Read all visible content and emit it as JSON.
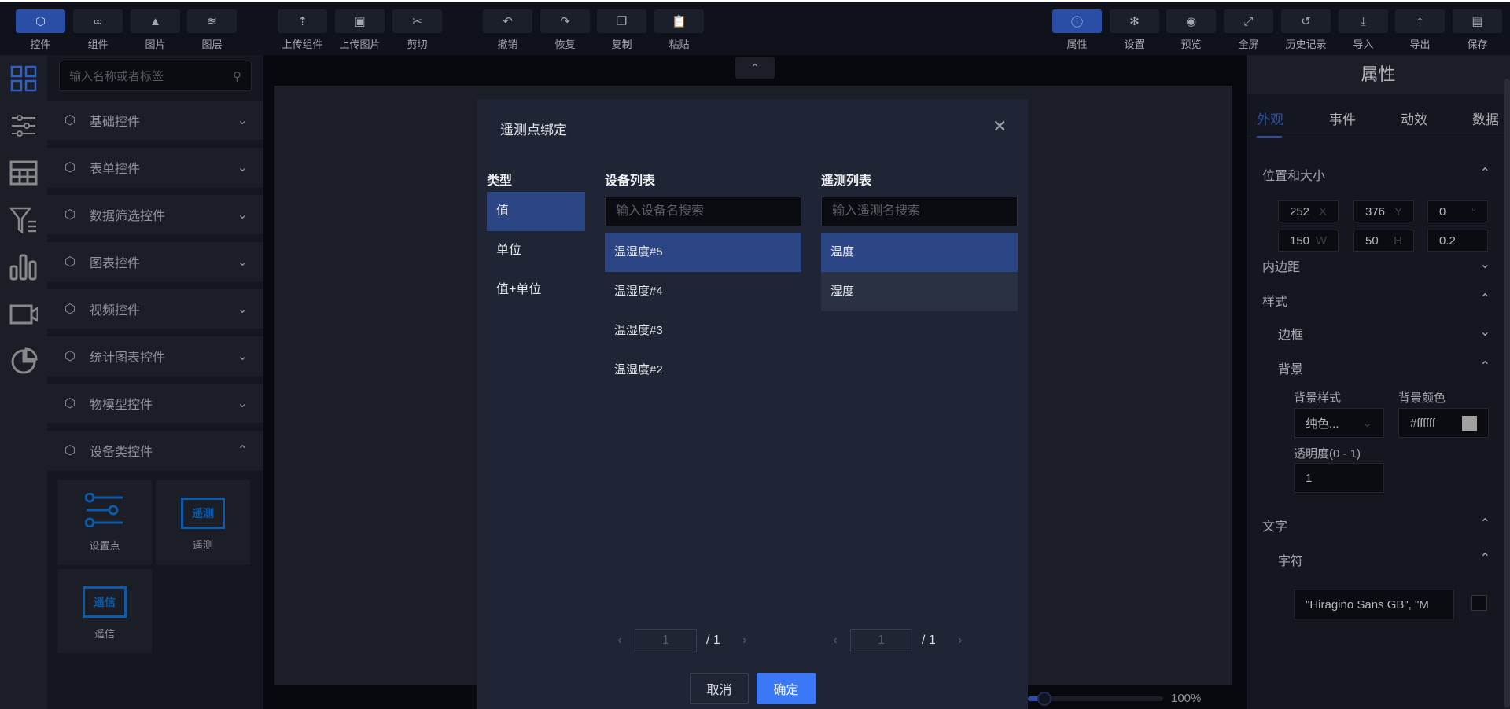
{
  "toolbar": {
    "left": [
      {
        "label": "控件",
        "icon": "cube-icon",
        "active": true
      },
      {
        "label": "组件",
        "icon": "link-icon"
      },
      {
        "label": "图片",
        "icon": "image-icon"
      },
      {
        "label": "图层",
        "icon": "layers-icon"
      },
      {
        "label": "上传组件",
        "icon": "upload-component-icon"
      },
      {
        "label": "上传图片",
        "icon": "upload-image-icon"
      },
      {
        "label": "剪切",
        "icon": "cut-icon"
      },
      {
        "label": "撤销",
        "icon": "undo-icon"
      },
      {
        "label": "恢复",
        "icon": "redo-icon"
      },
      {
        "label": "复制",
        "icon": "copy-icon"
      },
      {
        "label": "粘贴",
        "icon": "paste-icon"
      }
    ],
    "right": [
      {
        "label": "属性",
        "icon": "info-icon",
        "active": true
      },
      {
        "label": "设置",
        "icon": "gear-icon"
      },
      {
        "label": "预览",
        "icon": "eye-icon"
      },
      {
        "label": "全屏",
        "icon": "fullscreen-icon"
      },
      {
        "label": "历史记录",
        "icon": "history-icon"
      },
      {
        "label": "导入",
        "icon": "import-icon"
      },
      {
        "label": "导出",
        "icon": "export-icon"
      },
      {
        "label": "保存",
        "icon": "save-icon"
      }
    ]
  },
  "sidebar": {
    "search_placeholder": "输入名称或者标签",
    "categories": [
      "基础控件",
      "表单控件",
      "数据筛选控件",
      "图表控件",
      "视频控件",
      "统计图表控件",
      "物模型控件",
      "设备类控件"
    ],
    "tiles": [
      {
        "label": "设置点"
      },
      {
        "label": "遥测",
        "icon_text": "遥测"
      },
      {
        "label": "遥信",
        "icon_text": "遥信"
      }
    ]
  },
  "canvas": {
    "zoom": "100%",
    "zoom_fraction": 0.12
  },
  "properties": {
    "title": "属性",
    "tabs": [
      "外观",
      "事件",
      "动效",
      "数据"
    ],
    "sections": {
      "position": "位置和大小",
      "padding": "内边距",
      "style": "样式",
      "border": "边框",
      "background": "背景",
      "text": "文字",
      "font": "字符"
    },
    "fields": {
      "x": "252",
      "x_unit": "X",
      "y": "376",
      "y_unit": "Y",
      "rotate": "0",
      "rotate_unit": "°",
      "w": "150",
      "w_unit": "W",
      "h": "50",
      "h_unit": "H",
      "radius": "0.2"
    },
    "bg_style_label": "背景样式",
    "bg_style_value": "纯色...",
    "bg_color_label": "背景颜色",
    "bg_color_value": "#ffffff",
    "opacity_label": "透明度(0 - 1)",
    "opacity_value": "1",
    "font_value": "\"Hiragino Sans GB\", \"M"
  },
  "dialog": {
    "title": "遥测点绑定",
    "type_header": "类型",
    "types": [
      "值",
      "单位",
      "值+单位"
    ],
    "device_header": "设备列表",
    "device_placeholder": "输入设备名搜索",
    "devices": [
      "温湿度#5",
      "温湿度#4",
      "温湿度#3",
      "温湿度#2"
    ],
    "telemetry_header": "遥测列表",
    "telemetry_placeholder": "输入遥测名搜索",
    "telemetry": [
      "温度",
      "湿度"
    ],
    "device_page": {
      "current": "1",
      "total": "/ 1"
    },
    "telemetry_page": {
      "current": "1",
      "total": "/ 1"
    },
    "cancel": "取消",
    "confirm": "确定"
  }
}
